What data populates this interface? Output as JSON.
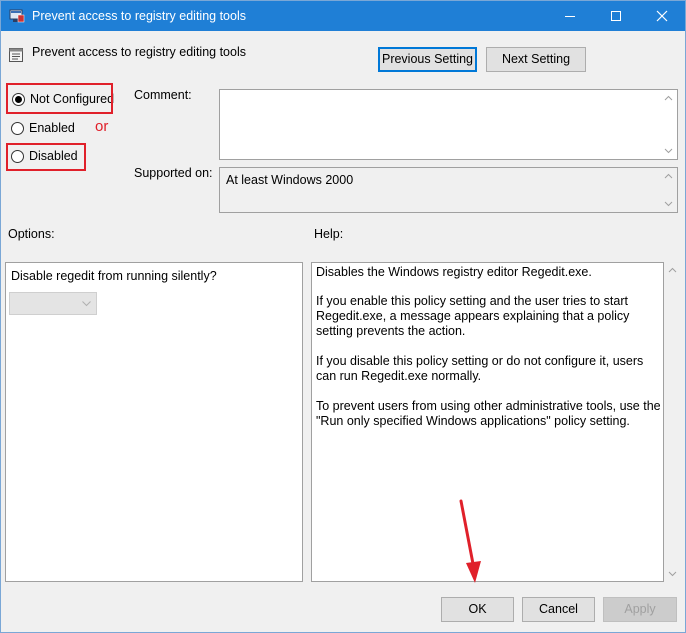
{
  "window": {
    "title": "Prevent access to registry editing tools",
    "titlebar_color": "#1f7fd6"
  },
  "header": {
    "policy_name": "Prevent access to registry editing tools",
    "previous_label": "Previous Setting",
    "next_label": "Next Setting"
  },
  "state": {
    "options": [
      {
        "label": "Not Configured",
        "selected": true
      },
      {
        "label": "Enabled",
        "selected": false
      },
      {
        "label": "Disabled",
        "selected": false
      }
    ],
    "annotation_or": "or",
    "annotation_color": "#e0202a"
  },
  "comment": {
    "label": "Comment:",
    "value": ""
  },
  "supported": {
    "label": "Supported on:",
    "value": "At least Windows 2000"
  },
  "options_panel": {
    "label": "Options:",
    "question": "Disable regedit from running silently?",
    "combo_value": ""
  },
  "help_panel": {
    "label": "Help:",
    "paragraphs": [
      "Disables the Windows registry editor Regedit.exe.",
      "If you enable this policy setting and the user tries to start Regedit.exe, a message appears explaining that a policy setting prevents the action.",
      "If you disable this policy setting or do not configure it, users can run Regedit.exe normally.",
      "To prevent users from using other administrative tools, use the \"Run only specified Windows applications\" policy setting."
    ]
  },
  "footer": {
    "ok_label": "OK",
    "cancel_label": "Cancel",
    "apply_label": "Apply"
  }
}
